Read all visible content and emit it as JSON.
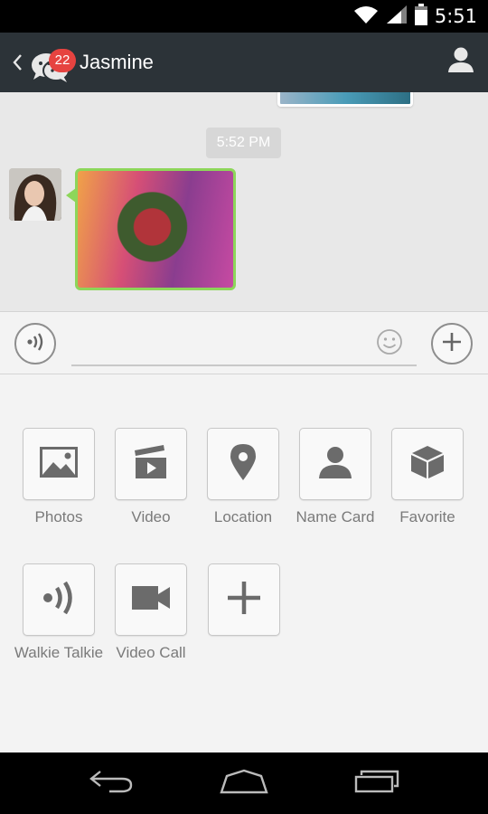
{
  "status_bar": {
    "time": "5:51",
    "icons": [
      "wifi-icon",
      "signal-icon",
      "battery-icon"
    ]
  },
  "title_bar": {
    "unread_badge": "22",
    "contact_name": "Jasmine",
    "icons": [
      "back-chevron-icon",
      "chats-icon",
      "profile-icon"
    ]
  },
  "chat": {
    "timestamp": "5:52 PM"
  },
  "input_bar": {
    "message_value": "",
    "icons": [
      "voice-icon",
      "emoji-icon",
      "plus-icon"
    ]
  },
  "attachments": [
    {
      "label": "Photos",
      "icon": "photos-icon"
    },
    {
      "label": "Video",
      "icon": "video-icon"
    },
    {
      "label": "Location",
      "icon": "location-pin-icon"
    },
    {
      "label": "Name Card",
      "icon": "name-card-icon"
    },
    {
      "label": "Favorite",
      "icon": "favorite-box-icon"
    },
    {
      "label": "Walkie Talkie",
      "icon": "walkie-talkie-icon"
    },
    {
      "label": "Video Call",
      "icon": "video-call-icon"
    },
    {
      "label": "",
      "icon": "add-more-icon"
    }
  ],
  "nav_bar": {
    "icons": [
      "back-icon",
      "home-icon",
      "recents-icon"
    ]
  },
  "colors": {
    "title_bar": "#2c3338",
    "badge": "#e64340",
    "bubble_border": "#8dd65a",
    "chat_bg": "#e8e8e8",
    "panel_bg": "#f3f3f3"
  }
}
